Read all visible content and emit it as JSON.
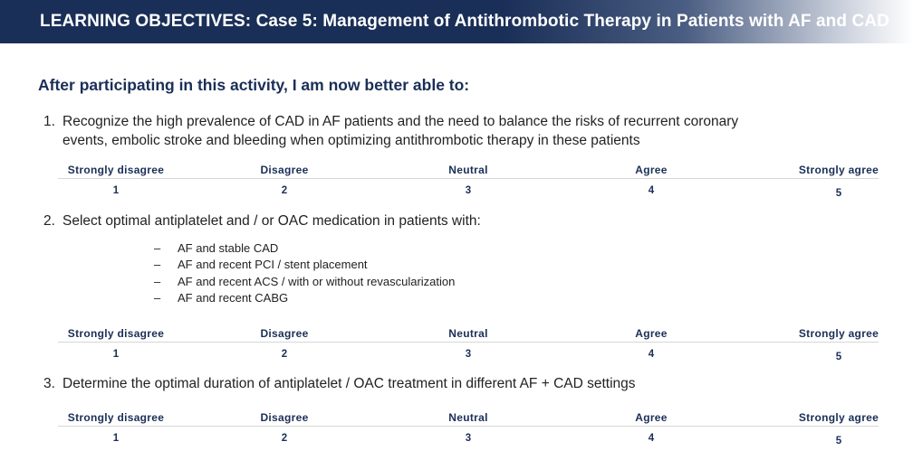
{
  "header": {
    "title": "LEARNING OBJECTIVES:  Case 5: Management of Antithrombotic Therapy in Patients with AF and CAD"
  },
  "intro": "After participating in this activity, I am now better able to:",
  "scale": {
    "labels": [
      "Strongly disagree",
      "Disagree",
      "Neutral",
      "Agree",
      "Strongly agree"
    ],
    "numbers": [
      "1",
      "2",
      "3",
      "4",
      "5"
    ]
  },
  "objectives": [
    {
      "number": "1.",
      "text": "Recognize the high prevalence of CAD in AF patients and the need to balance the risks of recurrent coronary events, embolic stroke and bleeding when optimizing antithrombotic therapy in these patients"
    },
    {
      "number": "2.",
      "text": "Select optimal antiplatelet and / or OAC medication in patients with:",
      "subitems": [
        "AF and stable CAD",
        "AF and recent PCI / stent placement",
        "AF and recent ACS / with or without revascularization",
        "AF and recent CABG"
      ]
    },
    {
      "number": "3.",
      "text": "Determine the optimal duration of antiplatelet / OAC treatment in different AF + CAD settings"
    }
  ]
}
